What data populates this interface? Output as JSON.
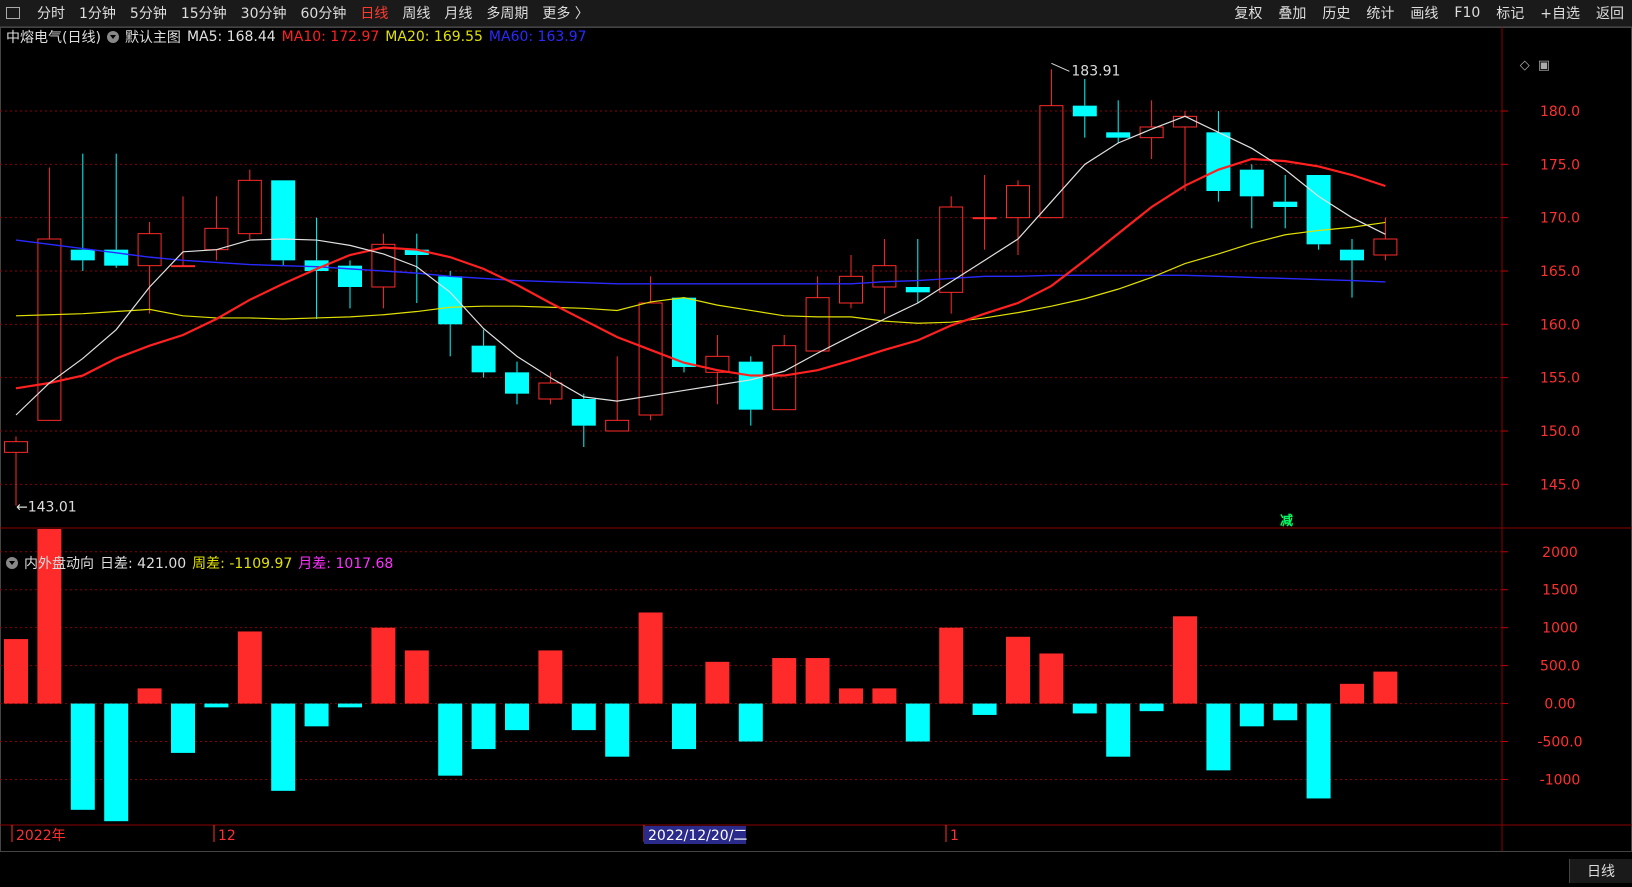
{
  "toolbar": {
    "periods": [
      "分时",
      "1分钟",
      "5分钟",
      "15分钟",
      "30分钟",
      "60分钟",
      "日线",
      "周线",
      "月线",
      "多周期",
      "更多 〉"
    ],
    "active_period": "日线",
    "right": [
      "复权",
      "叠加",
      "历史",
      "统计",
      "画线",
      "F10",
      "标记",
      "+自选",
      "返回"
    ]
  },
  "main_info": {
    "title": "中熔电气(日线)",
    "template": "默认主图",
    "ma5": "MA5: 168.44",
    "ma10": "MA10: 172.97",
    "ma20": "MA20: 169.55",
    "ma60": "MA60: 163.97"
  },
  "sub_info": {
    "title": "内外盘动向",
    "day": "日差: 421.00",
    "week": "周差: -1109.97",
    "month": "月差: 1017.68"
  },
  "colors": {
    "up": "#ff2a2a",
    "down": "#00ffff",
    "ma5": "#e0e0e0",
    "ma10": "#ff2020",
    "ma20": "#e0e000",
    "ma60": "#2a2aff",
    "grid": "#8b0000"
  },
  "annotations": {
    "high_label": "183.91",
    "low_label": "←143.01",
    "reduce_mark": "减"
  },
  "x_axis": {
    "labels": [
      "2022年",
      "12",
      "2022/12/20/二",
      "1"
    ]
  },
  "bottom_tab": "日线",
  "chart_data": {
    "type": "candlestick",
    "price_axis": {
      "ticks": [
        145,
        150,
        155,
        160,
        165,
        170,
        175,
        180
      ],
      "range": [
        141,
        186
      ]
    },
    "sub_axis": {
      "ticks": [
        -1000,
        -500,
        0,
        500,
        1000,
        1500,
        2000
      ],
      "tick_labels": [
        "-1000",
        "-500.0",
        "0.00",
        "500.0",
        "1000",
        "1500",
        "2000"
      ],
      "range": [
        -1600,
        2300
      ]
    },
    "candles": [
      {
        "o": 148.0,
        "c": 149.0,
        "h": 149.5,
        "l": 143.01
      },
      {
        "o": 151.0,
        "c": 168.0,
        "h": 174.7,
        "l": 151.0
      },
      {
        "o": 167.0,
        "c": 166.0,
        "h": 176.0,
        "l": 165.0
      },
      {
        "o": 167.0,
        "c": 165.5,
        "h": 176.0,
        "l": 165.3
      },
      {
        "o": 165.5,
        "c": 168.5,
        "h": 169.6,
        "l": 161.0
      },
      {
        "o": 165.5,
        "c": 165.5,
        "h": 172.0,
        "l": 165.5
      },
      {
        "o": 167.0,
        "c": 169.0,
        "h": 172.0,
        "l": 166.0
      },
      {
        "o": 168.5,
        "c": 173.5,
        "h": 174.5,
        "l": 168.0
      },
      {
        "o": 173.5,
        "c": 166.0,
        "h": 173.5,
        "l": 165.5
      },
      {
        "o": 166.0,
        "c": 165.0,
        "h": 170.0,
        "l": 160.5
      },
      {
        "o": 165.5,
        "c": 163.5,
        "h": 166.0,
        "l": 161.5
      },
      {
        "o": 163.5,
        "c": 167.5,
        "h": 168.5,
        "l": 161.5
      },
      {
        "o": 167.0,
        "c": 166.5,
        "h": 168.5,
        "l": 162.0
      },
      {
        "o": 164.5,
        "c": 160.0,
        "h": 165.0,
        "l": 157.0
      },
      {
        "o": 158.0,
        "c": 155.5,
        "h": 159.5,
        "l": 155.0
      },
      {
        "o": 155.5,
        "c": 153.5,
        "h": 156.5,
        "l": 152.5
      },
      {
        "o": 153.0,
        "c": 154.5,
        "h": 155.5,
        "l": 152.5
      },
      {
        "o": 153.0,
        "c": 150.5,
        "h": 153.5,
        "l": 148.5
      },
      {
        "o": 150.0,
        "c": 151.0,
        "h": 157.0,
        "l": 150.0
      },
      {
        "o": 151.5,
        "c": 162.0,
        "h": 164.5,
        "l": 151.0
      },
      {
        "o": 162.5,
        "c": 156.0,
        "h": 162.5,
        "l": 155.5
      },
      {
        "o": 155.5,
        "c": 157.0,
        "h": 159.0,
        "l": 152.5
      },
      {
        "o": 156.5,
        "c": 152.0,
        "h": 157.0,
        "l": 150.5
      },
      {
        "o": 152.0,
        "c": 158.0,
        "h": 159.0,
        "l": 152.0
      },
      {
        "o": 157.5,
        "c": 162.5,
        "h": 164.5,
        "l": 157.5
      },
      {
        "o": 162.0,
        "c": 164.5,
        "h": 166.5,
        "l": 161.5
      },
      {
        "o": 163.5,
        "c": 165.5,
        "h": 168.0,
        "l": 161.0
      },
      {
        "o": 163.5,
        "c": 163.0,
        "h": 168.0,
        "l": 162.0
      },
      {
        "o": 163.0,
        "c": 171.0,
        "h": 172.0,
        "l": 161.0
      },
      {
        "o": 170.0,
        "c": 170.0,
        "h": 174.0,
        "l": 167.0
      },
      {
        "o": 170.0,
        "c": 173.0,
        "h": 173.5,
        "l": 166.5
      },
      {
        "o": 170.0,
        "c": 180.5,
        "h": 183.91,
        "l": 170.0
      },
      {
        "o": 180.5,
        "c": 179.5,
        "h": 183.0,
        "l": 177.5
      },
      {
        "o": 178.0,
        "c": 177.5,
        "h": 181.0,
        "l": 177.0
      },
      {
        "o": 177.5,
        "c": 178.5,
        "h": 181.0,
        "l": 175.5
      },
      {
        "o": 178.5,
        "c": 179.5,
        "h": 180.0,
        "l": 172.5
      },
      {
        "o": 178.0,
        "c": 172.5,
        "h": 180.0,
        "l": 171.5
      },
      {
        "o": 174.5,
        "c": 172.0,
        "h": 175.0,
        "l": 169.0
      },
      {
        "o": 171.5,
        "c": 171.0,
        "h": 174.0,
        "l": 169.0
      },
      {
        "o": 174.0,
        "c": 167.5,
        "h": 174.0,
        "l": 167.0
      },
      {
        "o": 167.0,
        "c": 166.0,
        "h": 168.0,
        "l": 162.5
      },
      {
        "o": 166.5,
        "c": 168.0,
        "h": 170.0,
        "l": 166.0
      }
    ],
    "ma5": [
      151.5,
      154.5,
      156.8,
      159.5,
      163.5,
      166.8,
      167.0,
      167.9,
      168.0,
      167.9,
      167.4,
      166.6,
      165.4,
      163.0,
      159.6,
      157.0,
      155.0,
      153.2,
      152.8,
      153.3,
      153.8,
      154.3,
      154.8,
      155.6,
      157.3,
      158.9,
      160.5,
      162.0,
      164.0,
      166.0,
      168.0,
      171.5,
      175.0,
      177.0,
      178.3,
      179.5,
      178.0,
      176.5,
      174.5,
      172.0,
      170.0,
      168.44
    ],
    "ma10": [
      154.0,
      154.5,
      155.2,
      156.8,
      158.0,
      159.0,
      160.5,
      162.3,
      163.8,
      165.2,
      166.5,
      167.2,
      167.0,
      166.3,
      165.2,
      163.7,
      162.0,
      160.4,
      158.8,
      157.6,
      156.4,
      155.7,
      155.2,
      155.2,
      155.7,
      156.6,
      157.6,
      158.5,
      159.9,
      161.0,
      162.0,
      163.6,
      166.0,
      168.5,
      171.0,
      173.0,
      174.5,
      175.5,
      175.3,
      174.8,
      174.0,
      172.97
    ],
    "ma20": [
      160.8,
      160.9,
      161.0,
      161.2,
      161.4,
      160.8,
      160.6,
      160.6,
      160.5,
      160.6,
      160.7,
      160.9,
      161.2,
      161.6,
      161.7,
      161.7,
      161.6,
      161.5,
      161.3,
      162.1,
      162.5,
      161.8,
      161.3,
      160.8,
      160.7,
      160.7,
      160.3,
      160.1,
      160.2,
      160.6,
      161.1,
      161.7,
      162.4,
      163.3,
      164.4,
      165.7,
      166.6,
      167.6,
      168.4,
      168.8,
      169.1,
      169.55
    ],
    "ma60": [
      167.9,
      167.5,
      167.1,
      166.7,
      166.3,
      166.0,
      165.8,
      165.6,
      165.5,
      165.4,
      165.2,
      165.0,
      164.8,
      164.5,
      164.3,
      164.1,
      164.0,
      163.9,
      163.8,
      163.8,
      163.8,
      163.8,
      163.8,
      163.8,
      163.8,
      163.8,
      164.0,
      164.1,
      164.3,
      164.5,
      164.5,
      164.6,
      164.6,
      164.6,
      164.6,
      164.6,
      164.5,
      164.4,
      164.3,
      164.2,
      164.1,
      163.97
    ],
    "sub_values": [
      850,
      2300,
      -1400,
      -1550,
      200,
      -650,
      -50,
      950,
      -1150,
      -300,
      -50,
      1000,
      700,
      -950,
      -600,
      -350,
      700,
      -350,
      -700,
      1200,
      -600,
      550,
      -500,
      600,
      600,
      200,
      200,
      -500,
      1000,
      -150,
      880,
      660,
      -130,
      -700,
      -100,
      1150,
      -880,
      -300,
      -220,
      -1250,
      260,
      421
    ]
  }
}
